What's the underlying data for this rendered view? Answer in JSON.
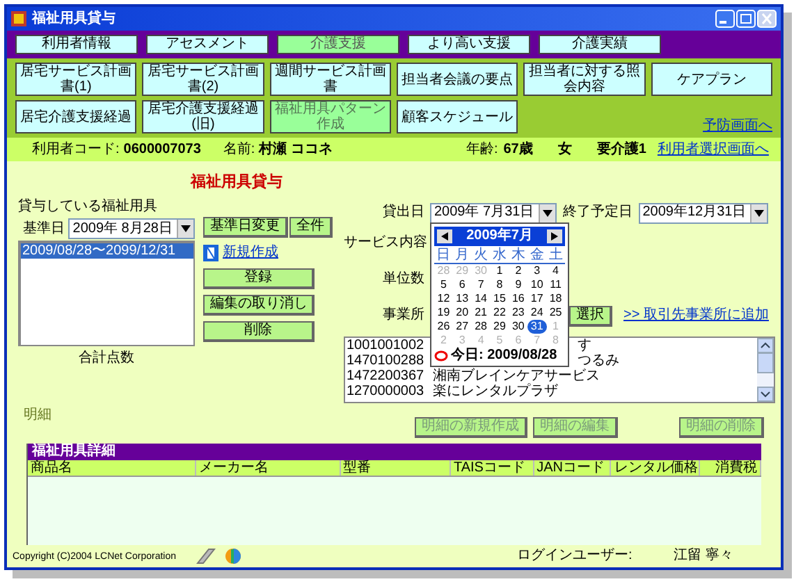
{
  "window": {
    "title": "福祉用具貸与"
  },
  "main_tabs": [
    {
      "label": "利用者情報",
      "selected": false
    },
    {
      "label": "アセスメント",
      "selected": false
    },
    {
      "label": "介護支援",
      "selected": true
    },
    {
      "label": "より高い支援",
      "selected": false
    },
    {
      "label": "介護実績",
      "selected": false
    }
  ],
  "sub_tabs": [
    {
      "label": "居宅サービス計画書(1)",
      "selected": false
    },
    {
      "label": "居宅サービス計画書(2)",
      "selected": false
    },
    {
      "label": "週間サービス計画書",
      "selected": false
    },
    {
      "label": "担当者会議の要点",
      "selected": false
    },
    {
      "label": "担当者に対する照会内容",
      "selected": false
    },
    {
      "label": "ケアプラン",
      "selected": false
    },
    {
      "label": "居宅介護支援経過",
      "selected": false
    },
    {
      "label": "居宅介護支援経過(旧)",
      "selected": false
    },
    {
      "label": "福祉用具パターン作成",
      "selected": true
    },
    {
      "label": "顧客スケジュール",
      "selected": false
    }
  ],
  "prevention_link": "予防画面へ",
  "user": {
    "code_label": "利用者コード:",
    "code": "0600007073",
    "name_label": "名前:",
    "name": "村瀬 ココネ",
    "age_label": "年齢:",
    "age": "67歳",
    "sex": "女",
    "care_level": "要介護1",
    "select_link": "利用者選択画面へ"
  },
  "page_heading": "福祉用具貸与",
  "rentals": {
    "label": "貸与している福祉用具",
    "base_date_label": "基準日",
    "base_date": "2009年 8月28日",
    "change_button": "基準日変更",
    "all_button": "全件",
    "new_link": "新規作成",
    "total_label": "合計点数",
    "items": [
      {
        "text": "2009/08/28〜2099/12/31",
        "selected": true
      }
    ],
    "actions": [
      {
        "label": "登録",
        "disabled": false
      },
      {
        "label": "編集の取り消し",
        "disabled": false
      },
      {
        "label": "削除",
        "disabled": false
      }
    ]
  },
  "rental_form": {
    "start_label": "貸出日",
    "start_date": "2009年 7月31日",
    "end_label": "終了予定日",
    "end_date": "2009年12月31日",
    "service_label": "サービス内容",
    "units_label": "単位数",
    "office_label": "事業所",
    "office_select_button": "選択",
    "add_office_link": ">> 取引先事業所に追加",
    "offices": [
      {
        "code": "1001001002",
        "name": "す",
        "covered": true
      },
      {
        "code": "1470100288",
        "name": "つるみ",
        "covered": true
      },
      {
        "code": "1472200367",
        "name": "湘南ブレインケアサービス",
        "covered": false
      },
      {
        "code": "1270000003",
        "name": "楽にレンタルプラザ",
        "covered": false
      }
    ]
  },
  "calendar": {
    "month": "2009年7月",
    "weekdays": [
      "日",
      "月",
      "火",
      "水",
      "木",
      "金",
      "土"
    ],
    "weeks": [
      [
        {
          "d": "28",
          "muted": true,
          "selected": false
        },
        {
          "d": "29",
          "muted": true,
          "selected": false
        },
        {
          "d": "30",
          "muted": true,
          "selected": false
        },
        {
          "d": "1",
          "muted": false,
          "selected": false
        },
        {
          "d": "2",
          "muted": false,
          "selected": false
        },
        {
          "d": "3",
          "muted": false,
          "selected": false
        },
        {
          "d": "4",
          "muted": false,
          "selected": false
        }
      ],
      [
        {
          "d": "5",
          "muted": false,
          "selected": false
        },
        {
          "d": "6",
          "muted": false,
          "selected": false
        },
        {
          "d": "7",
          "muted": false,
          "selected": false
        },
        {
          "d": "8",
          "muted": false,
          "selected": false
        },
        {
          "d": "9",
          "muted": false,
          "selected": false
        },
        {
          "d": "10",
          "muted": false,
          "selected": false
        },
        {
          "d": "11",
          "muted": false,
          "selected": false
        }
      ],
      [
        {
          "d": "12",
          "muted": false,
          "selected": false
        },
        {
          "d": "13",
          "muted": false,
          "selected": false
        },
        {
          "d": "14",
          "muted": false,
          "selected": false
        },
        {
          "d": "15",
          "muted": false,
          "selected": false
        },
        {
          "d": "16",
          "muted": false,
          "selected": false
        },
        {
          "d": "17",
          "muted": false,
          "selected": false
        },
        {
          "d": "18",
          "muted": false,
          "selected": false
        }
      ],
      [
        {
          "d": "19",
          "muted": false,
          "selected": false
        },
        {
          "d": "20",
          "muted": false,
          "selected": false
        },
        {
          "d": "21",
          "muted": false,
          "selected": false
        },
        {
          "d": "22",
          "muted": false,
          "selected": false
        },
        {
          "d": "23",
          "muted": false,
          "selected": false
        },
        {
          "d": "24",
          "muted": false,
          "selected": false
        },
        {
          "d": "25",
          "muted": false,
          "selected": false
        }
      ],
      [
        {
          "d": "26",
          "muted": false,
          "selected": false
        },
        {
          "d": "27",
          "muted": false,
          "selected": false
        },
        {
          "d": "28",
          "muted": false,
          "selected": false
        },
        {
          "d": "29",
          "muted": false,
          "selected": false
        },
        {
          "d": "30",
          "muted": false,
          "selected": false
        },
        {
          "d": "31",
          "muted": false,
          "selected": true
        },
        {
          "d": "1",
          "muted": true,
          "selected": false
        }
      ],
      [
        {
          "d": "2",
          "muted": true,
          "selected": false
        },
        {
          "d": "3",
          "muted": true,
          "selected": false
        },
        {
          "d": "4",
          "muted": true,
          "selected": false
        },
        {
          "d": "5",
          "muted": true,
          "selected": false
        },
        {
          "d": "6",
          "muted": true,
          "selected": false
        },
        {
          "d": "7",
          "muted": true,
          "selected": false
        },
        {
          "d": "8",
          "muted": true,
          "selected": false
        }
      ]
    ],
    "today": "今日: 2009/08/28"
  },
  "details": {
    "label": "明細",
    "table_title": "福祉用具詳細",
    "buttons": [
      {
        "label": "明細の新規作成",
        "disabled": true
      },
      {
        "label": "明細の編集",
        "disabled": true
      },
      {
        "label": "明細の削除",
        "disabled": true
      }
    ],
    "columns": [
      "商品名",
      "メーカー名",
      "型番",
      "TAISコード",
      "JANコード",
      "レンタル価格",
      "消費税"
    ]
  },
  "footer": {
    "copyright": "Copyright (C)2004 LCNet Corporation",
    "login_label": "ログインユーザー:",
    "login_user": "江留 寧々"
  }
}
